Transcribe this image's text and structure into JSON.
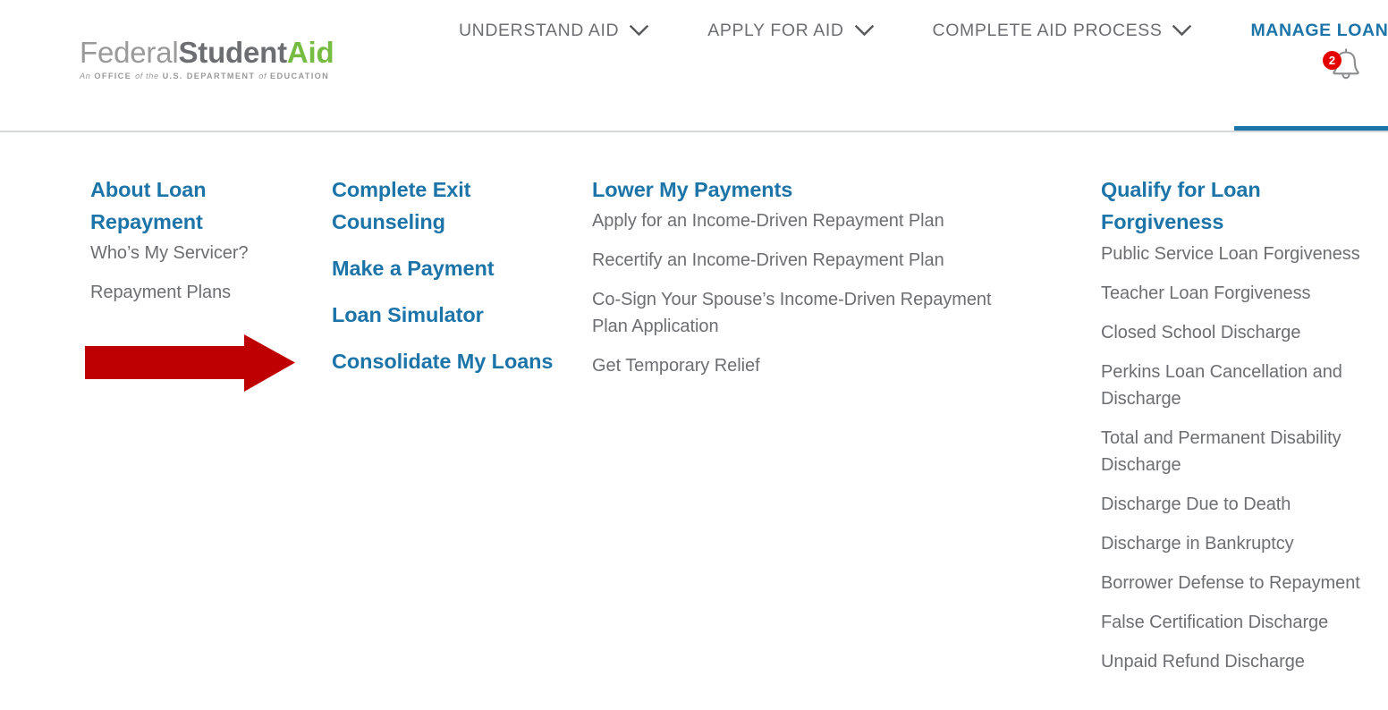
{
  "header": {
    "logo": {
      "word1": "Federal",
      "word2": "Student",
      "word3": "Aid",
      "tagline_part1": "An",
      "tagline_part2": "OFFICE",
      "tagline_part3": "of the",
      "tagline_part4": "U.S. DEPARTMENT",
      "tagline_part5": "of",
      "tagline_part6": "EDUCATION",
      "colors": {
        "federal": "#9a9a9a",
        "student": "#6d6e71",
        "aid": "#76bc43"
      }
    },
    "nav": [
      {
        "label": "UNDERSTAND AID",
        "active": false,
        "icon": "chevron-down-icon"
      },
      {
        "label": "APPLY FOR AID",
        "active": false,
        "icon": "chevron-down-icon"
      },
      {
        "label": "COMPLETE AID PROCESS",
        "active": false,
        "icon": "chevron-down-icon"
      },
      {
        "label": "MANAGE LOANS",
        "active": true,
        "icon": "chevron-down-icon"
      }
    ],
    "notifications": {
      "icon": "bell-icon",
      "count": "2",
      "badge_color": "#e30000"
    }
  },
  "megamenu": {
    "accent_color": "#1c74a8",
    "text_color": "#6d6e71",
    "columns": [
      {
        "heading": "About Loan Repayment",
        "links": [
          "Who’s My Servicer?",
          "Repayment Plans"
        ]
      },
      {
        "heading": "Complete Exit Counseling",
        "links": [
          "Make a Payment",
          "Loan Simulator",
          "Consolidate My Loans"
        ]
      },
      {
        "heading": "Lower My Payments",
        "links": [
          "Apply for an Income-Driven Repayment Plan",
          "Recertify an Income-Driven Repayment Plan",
          "Co-Sign Your Spouse’s Income-Driven Repayment Plan Application",
          "Get Temporary Relief"
        ]
      },
      {
        "heading": "Qualify for Loan Forgiveness",
        "links": [
          "Public Service Loan Forgiveness",
          "Teacher Loan Forgiveness",
          "Closed School Discharge",
          "Perkins Loan Cancellation and Discharge",
          "Total and Permanent Disability Discharge",
          "Discharge Due to Death",
          "Discharge in Bankruptcy",
          "Borrower Defense to Repayment",
          "False Certification Discharge",
          "Unpaid Refund Discharge"
        ]
      }
    ]
  },
  "annotation": {
    "type": "arrow",
    "direction": "right",
    "color": "#bf0000",
    "points_at": "Consolidate My Loans"
  }
}
